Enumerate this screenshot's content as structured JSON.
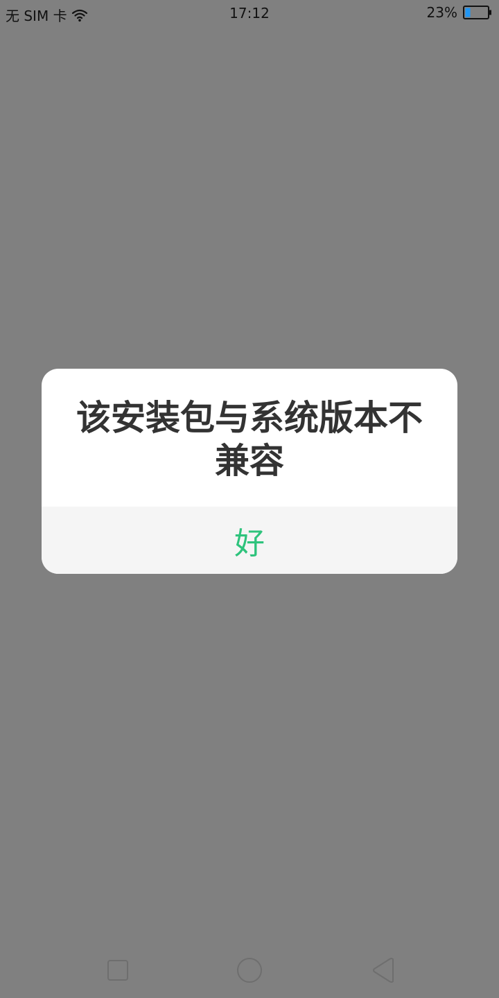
{
  "status_bar": {
    "carrier": "无 SIM 卡",
    "time": "17:12",
    "battery_percent": "23%",
    "battery_level": 0.23,
    "wifi_icon": "wifi-icon",
    "battery_icon": "battery-icon"
  },
  "dialog": {
    "message": "该安装包与系统版本不兼容",
    "ok_label": "好",
    "ok_color": "#2ec37c"
  },
  "nav_bar": {
    "icons": [
      "recents-icon",
      "home-icon",
      "back-icon"
    ]
  },
  "colors": {
    "scrim": "#808080",
    "dialog_bg": "#ffffff",
    "footer_bg": "#f5f5f5",
    "text": "#333333",
    "battery_fill": "#2196f3"
  }
}
